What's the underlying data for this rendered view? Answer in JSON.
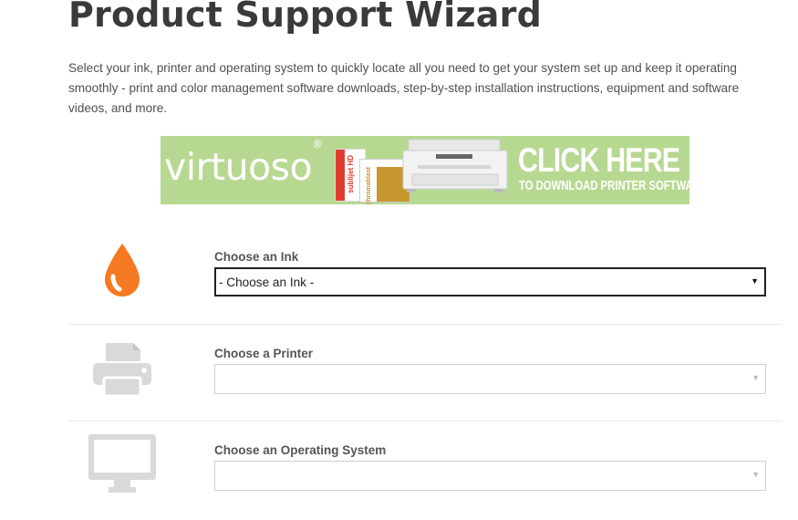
{
  "page": {
    "title": "Product Support Wizard",
    "intro": "Select your ink, printer and operating system to quickly locate all you need to get your system set up and keep it operating smoothly - print and color management software downloads, step-by-step installation instructions, equipment and software videos, and more."
  },
  "banner": {
    "brand": "virtuoso",
    "brand_mark": "®",
    "cta_main": "CLICK HERE",
    "cta_sub": "TO DOWNLOAD PRINTER SOFTWARE",
    "box1_text": "sublijet HD",
    "box2_text": "chromablast",
    "background_color": "#b7d891"
  },
  "wizard": {
    "ink": {
      "label": "Choose an Ink",
      "selected": "- Choose an Ink -",
      "icon": "ink-drop-icon",
      "icon_color": "#f57922",
      "enabled": true
    },
    "printer": {
      "label": "Choose a Printer",
      "selected": "",
      "icon": "printer-icon",
      "icon_color": "#d9d9d9",
      "enabled": false
    },
    "os": {
      "label": "Choose an Operating System",
      "selected": "",
      "icon": "monitor-icon",
      "icon_color": "#d9d9d9",
      "enabled": false
    }
  }
}
